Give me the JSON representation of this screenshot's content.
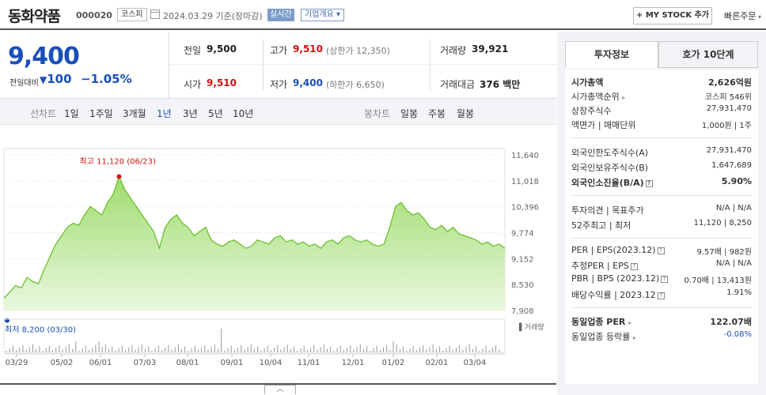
{
  "header": {
    "name": "동화약품",
    "code": "000020",
    "market": "코스피",
    "date": "2024.03.29",
    "basis": "기준(장마감)",
    "realtime": "실시간",
    "company_info": "기업개요",
    "mystock_button": "+ MY STOCK 추가",
    "quick_order": "빠른주문"
  },
  "price": {
    "current": "9,400",
    "diff_label": "전일대비",
    "diff_value": "100",
    "diff_percent": "−1.05%",
    "prev_label": "전일",
    "prev_value": "9,500",
    "high_label": "고가",
    "high_value": "9,510",
    "upper_limit": "(상한가 12,350)",
    "volume_label": "거래량",
    "volume_value": "39,921",
    "open_label": "시가",
    "open_value": "9,510",
    "low_label": "저가",
    "low_value": "9,400",
    "lower_limit": "(하한가 6,650)",
    "amount_label": "거래대금",
    "amount_value": "376 백만"
  },
  "periods": {
    "line_label": "선차트",
    "line_items": [
      "1일",
      "1주일",
      "3개월",
      "1년",
      "3년",
      "5년",
      "10년"
    ],
    "active": "1년",
    "candle_label": "봉차트",
    "candle_items": [
      "일봉",
      "주봉",
      "월봉"
    ]
  },
  "chart_data": {
    "type": "area",
    "title": "",
    "x_ticks": [
      "03/29",
      "05/02",
      "06/01",
      "07/03",
      "08/01",
      "09/01",
      "10/04",
      "11/01",
      "12/01",
      "01/02",
      "02/01",
      "03/04"
    ],
    "y_ticks": [
      11640,
      11018,
      10396,
      9774,
      9152,
      8530,
      7908
    ],
    "ylim": [
      7908,
      11640
    ],
    "high_annotation": "최고 11,120 (06/23)",
    "low_annotation": "최저 8,200 (03/30)",
    "volume_label": "거래량",
    "values": [
      8200,
      8350,
      8500,
      8450,
      8700,
      8600,
      8550,
      8900,
      9200,
      9500,
      9700,
      9900,
      10000,
      9950,
      10200,
      10400,
      10300,
      10200,
      10500,
      10700,
      11120,
      10800,
      10600,
      10400,
      10200,
      10000,
      9800,
      9400,
      9900,
      10100,
      10200,
      10000,
      9900,
      9700,
      9800,
      9900,
      9600,
      9500,
      9450,
      9550,
      9600,
      9500,
      9400,
      9450,
      9600,
      9550,
      9500,
      9650,
      9700,
      9550,
      9600,
      9500,
      9550,
      9450,
      9500,
      9400,
      9550,
      9600,
      9500,
      9650,
      9700,
      9600,
      9550,
      9600,
      9500,
      9450,
      9500,
      9900,
      10400,
      10500,
      10300,
      10200,
      10250,
      10100,
      9900,
      9850,
      9950,
      9800,
      9900,
      9750,
      9700,
      9650,
      9600,
      9500,
      9550,
      9450,
      9500,
      9400
    ]
  },
  "sidebar": {
    "tab_info": "투자정보",
    "tab_orderbook": "호가 10단계",
    "market_cap_label": "시가총액",
    "market_cap_value": "2,626억원",
    "cap_rank_label": "시가총액순위",
    "cap_rank_value": "코스피 546위",
    "shares_label": "상장주식수",
    "shares_value": "27,931,470",
    "face_label": "액면가 | 매매단위",
    "face_value": "1,000원 | 1주",
    "foreign_limit_label": "외국인한도주식수(A)",
    "foreign_limit_value": "27,931,470",
    "foreign_hold_label": "외국인보유주식수(B)",
    "foreign_hold_value": "1,647,689",
    "foreign_ratio_label": "외국인소진율(B/A)",
    "foreign_ratio_value": "5.90%",
    "opinion_label": "투자의견 | 목표주가",
    "opinion_value": "N/A | N/A",
    "range52_label": "52주최고 | 최저",
    "range52_value": "11,120 | 8,250",
    "per_label": "PER | EPS(2023.12)",
    "per_value": "9.57배 | 982원",
    "est_per_label": "추정PER | EPS",
    "est_per_value": "N/A | N/A",
    "pbr_label": "PBR | BPS (2023.12)",
    "pbr_value": "0.70배 | 13,413원",
    "dividend_label": "배당수익률 | 2023.12",
    "dividend_value": "1.91%",
    "industry_per_label": "동일업종 PER",
    "industry_per_value": "122.07배",
    "industry_change_label": "동일업종 등락률",
    "industry_change_value": "-0.08%"
  }
}
